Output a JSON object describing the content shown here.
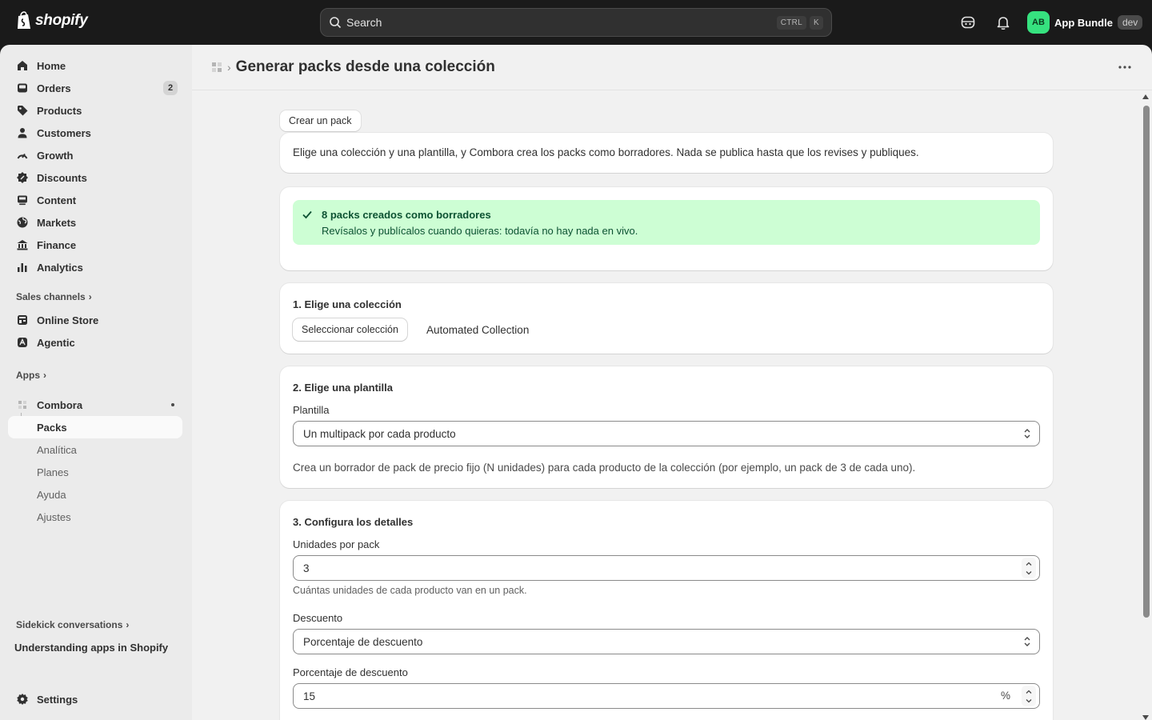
{
  "topbar": {
    "brand": "shopify",
    "search_placeholder": "Search",
    "shortcut_ctrl": "CTRL",
    "shortcut_key": "K",
    "store_initials": "AB",
    "store_name": "App Bundle",
    "store_badge": "dev"
  },
  "sidebar": {
    "items": [
      {
        "label": "Home",
        "icon": "home-icon"
      },
      {
        "label": "Orders",
        "icon": "inbox-icon",
        "badge": "2"
      },
      {
        "label": "Products",
        "icon": "tag-icon"
      },
      {
        "label": "Customers",
        "icon": "person-icon"
      },
      {
        "label": "Growth",
        "icon": "gauge-icon"
      },
      {
        "label": "Discounts",
        "icon": "discount-icon"
      },
      {
        "label": "Content",
        "icon": "content-icon"
      },
      {
        "label": "Markets",
        "icon": "globe-icon"
      },
      {
        "label": "Finance",
        "icon": "bank-icon"
      },
      {
        "label": "Analytics",
        "icon": "bar-chart-icon"
      }
    ],
    "sales_channels_label": "Sales channels",
    "channels": [
      {
        "label": "Online Store",
        "icon": "store-icon"
      },
      {
        "label": "Agentic",
        "icon": "robot-icon"
      }
    ],
    "apps_label": "Apps",
    "app_name": "Combora",
    "app_subitems": [
      "Packs",
      "Analítica",
      "Planes",
      "Ayuda",
      "Ajustes"
    ],
    "sidekick_label": "Sidekick conversations",
    "sidekick_item": "Understanding apps in Shopify",
    "settings_label": "Settings"
  },
  "page": {
    "title": "Generar packs desde una colección",
    "create_pack_button": "Crear un pack",
    "intro": "Elige una colección y una plantilla, y Combora crea los packs como borradores. Nada se publica hasta que los revises y publiques.",
    "banner": {
      "title": "8 packs creados como borradores",
      "body": "Revísalos y publícalos cuando quieras: todavía no hay nada en vivo.",
      "color": "#cdfed4"
    },
    "step1": {
      "heading": "1. Elige una colección",
      "button": "Seleccionar colección",
      "selected": "Automated Collection"
    },
    "step2": {
      "heading": "2. Elige una plantilla",
      "label": "Plantilla",
      "value": "Un multipack por cada producto",
      "description": "Crea un borrador de pack de precio fijo (N unidades) para cada producto de la colección (por ejemplo, un pack de 3 de cada uno)."
    },
    "step3": {
      "heading": "3. Configura los detalles",
      "units_label": "Unidades por pack",
      "units_value": "3",
      "units_help": "Cuántas unidades de cada producto van en un pack.",
      "discount_label": "Descuento",
      "discount_value": "Porcentaje de descuento",
      "percent_label": "Porcentaje de descuento",
      "percent_value": "15",
      "percent_suffix": "%"
    }
  }
}
